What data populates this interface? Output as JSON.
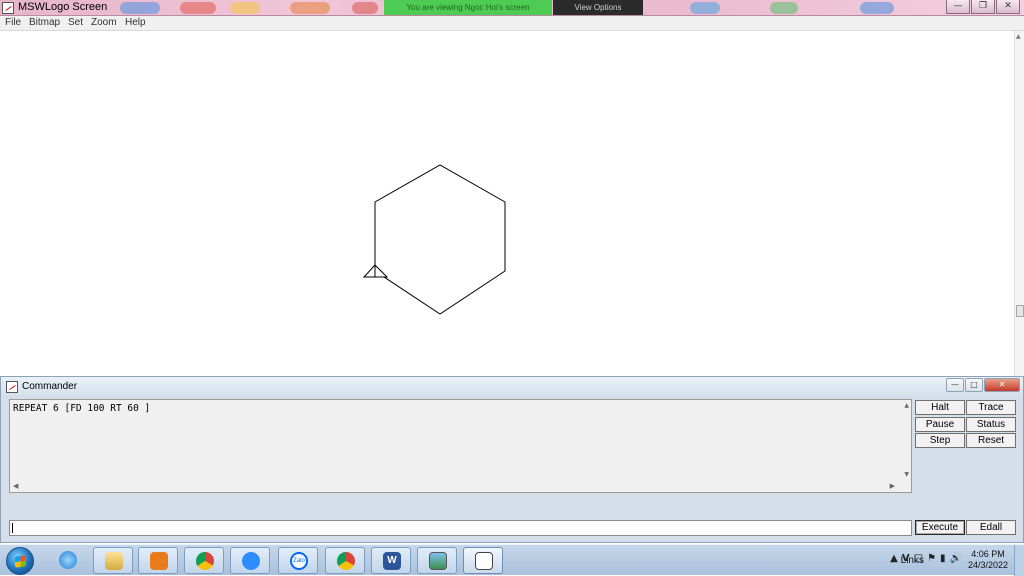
{
  "window": {
    "title": "MSWLogo Screen",
    "zoom_notice": "You are viewing Ngoc Hoi's screen",
    "zoom_options": "View Options"
  },
  "menu": [
    "File",
    "Bitmap",
    "Set",
    "Zoom",
    "Help"
  ],
  "turtle_program": {
    "command": "REPEAT 6 [FD 100 RT 60 ]",
    "sides": 6,
    "step": 100,
    "turn_degrees": 60
  },
  "commander": {
    "title": "Commander",
    "history_text": "REPEAT 6 [FD 100 RT 60 ]",
    "input_value": "",
    "buttons": {
      "halt": "Halt",
      "trace": "Trace",
      "pause": "Pause",
      "status": "Status",
      "step": "Step",
      "reset": "Reset",
      "execute": "Execute",
      "edall": "Edall"
    }
  },
  "taskbar": {
    "apps": [
      "start-orb",
      "internet-explorer-icon",
      "file-explorer-icon",
      "media-player-icon",
      "chrome-icon",
      "zoom-icon",
      "zalo-icon",
      "chrome-profile-icon",
      "word-icon",
      "photo-viewer-icon",
      "mswlogo-icon"
    ],
    "zalo_label": "Zalo",
    "links_label": "Links",
    "time": "4:06 PM",
    "date": "24/3/2022"
  },
  "colors": {
    "canvas": "#ffffff",
    "pen": "#000000",
    "zoom_banner": "#4ecb52",
    "taskbar": "#b8cde5"
  }
}
